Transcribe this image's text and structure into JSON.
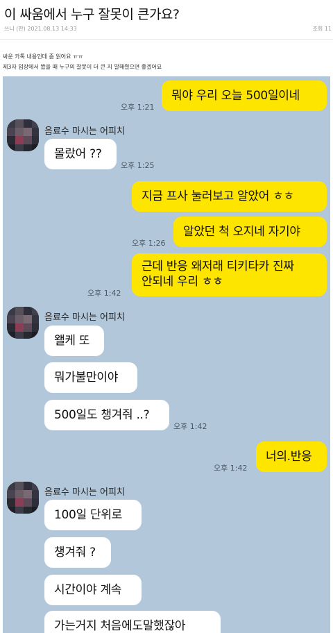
{
  "post": {
    "title": "이 싸움에서 누구 잘못이 큰가요?",
    "author_date": "쓰니 (판)  2021.08.13 14:33",
    "views": "조회 11",
    "body_line1": "싸운 카톡 내용인데 좀 읽어요 ㅠㅠ",
    "body_line2": "제3자 입장에서 봤을 때 누구의 잘못이 더 큰 지 말해줬으면 좋겠어요"
  },
  "chat": {
    "sender_name": "음료수 마시는 어피치",
    "messages": [
      {
        "side": "mine",
        "text": "뭐야 우리 오늘 500일이네",
        "time": "오후 1:21"
      },
      {
        "side": "theirs",
        "text": "몰랐어 ??",
        "time": "오후 1:25"
      },
      {
        "side": "mine",
        "text": "지금 프사 눌러보고 알았어 ㅎㅎ",
        "time": ""
      },
      {
        "side": "mine",
        "text": "알았던 척 오지네 자기야",
        "time": "오후 1:26"
      },
      {
        "side": "mine",
        "text": "근데 반응 왜저래 티키타카 진짜",
        "text2": "안되네 우리 ㅎㅎ",
        "time": "오후 1:42"
      },
      {
        "side": "theirs",
        "text": "왤케 또",
        "time": ""
      },
      {
        "side": "theirs",
        "text": "뭐가불만이야",
        "time": ""
      },
      {
        "side": "theirs",
        "text": "500일도 챙겨줘 ..?",
        "time": "오후 1:42"
      },
      {
        "side": "mine",
        "text": "너의.반응",
        "time": "오후 1:42"
      },
      {
        "side": "theirs",
        "text": "100일 단위로",
        "time": ""
      },
      {
        "side": "theirs",
        "text": "챙겨줘 ?",
        "time": ""
      },
      {
        "side": "theirs",
        "text": "시간이야 계속",
        "time": ""
      },
      {
        "side": "theirs",
        "text": "가는거지 처음에도말했잖아",
        "time": ""
      }
    ]
  },
  "colors": {
    "chat_bg": "#b2c7d9",
    "mine_bubble": "#fee500",
    "theirs_bubble": "#ffffff"
  }
}
